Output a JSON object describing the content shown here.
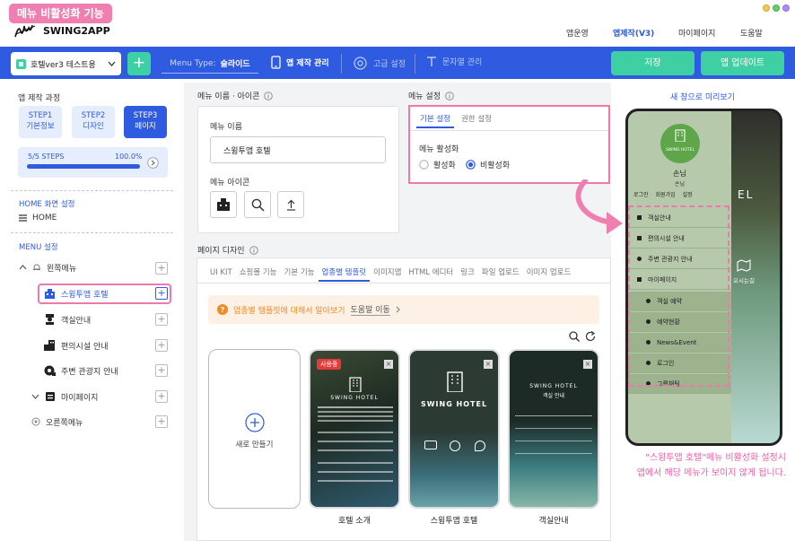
{
  "caption": "메뉴 비활성화 기능",
  "header": {
    "brand": "SWING2APP",
    "nav": [
      "앱운영",
      "앱제작(V3)",
      "마이페이지",
      "도움말"
    ]
  },
  "toolbar": {
    "app_name": "호텔ver3 테스트용",
    "menu_type_label": "Menu Type:",
    "menu_type_value": "슬라이드",
    "manage": "앱 제작 관리",
    "advanced": "고급 설정",
    "strings": "문자열 관리",
    "save": "저장",
    "update": "앱 업데이트"
  },
  "left": {
    "process_title": "앱 제작 과정",
    "steps": [
      {
        "line1": "STEP1",
        "line2": "기본정보"
      },
      {
        "line1": "STEP2",
        "line2": "디자인"
      },
      {
        "line1": "STEP3",
        "line2": "페이지"
      }
    ],
    "progress_label": "5/5 STEPS",
    "progress_text": "100.0%",
    "progress_value": 1.0,
    "home_section": "HOME 화면 설정",
    "home_item": "HOME",
    "menu_section": "MENU 설정",
    "tree": {
      "left_menu": "왼쪽메뉴",
      "items": [
        "스윙투앱 호텔",
        "객실안내",
        "편의시설 안내",
        "주변 관광지 안내"
      ],
      "mypage": "마이페이지",
      "right_menu": "오른쪽메뉴"
    }
  },
  "menu_name_panel": {
    "title": "메뉴 이름 · 아이콘",
    "name_label": "메뉴 이름",
    "name_value": "스윙투앱 호텔",
    "icon_label": "메뉴 아이콘"
  },
  "menu_settings": {
    "title": "메뉴 설정",
    "tabs": [
      "기본 설정",
      "권한 설정"
    ],
    "activate_label": "메뉴 활성화",
    "options": [
      "활성화",
      "비활성화"
    ],
    "selected": "비활성화"
  },
  "page_design": {
    "title": "페이지 디자인",
    "tabs": [
      "UI KIT",
      "쇼핑몰 기능",
      "기본 기능",
      "업종별 템플릿",
      "이미지맵",
      "HTML 에디터",
      "링크",
      "파일 업로드",
      "이미지 업로드"
    ],
    "active_tab": "업종별 템플릿",
    "banner_text": "업종별 템플릿에 대해서 알아보기",
    "banner_link": "도움말 이동",
    "new_label": "새로 만들기",
    "templates": [
      {
        "label": "호텔 소개",
        "badge": "사용중",
        "heading": "SWING HOTEL"
      },
      {
        "label": "스윙투앱 호텔",
        "heading": "SWING HOTEL"
      },
      {
        "label": "객실안내",
        "heading": "SWING HOTEL",
        "sub": "객실 안내"
      }
    ]
  },
  "preview": {
    "link": "새 창으로 미리보기",
    "hotel_name": "SWING HOTEL",
    "user": "손님",
    "user_sub": "손님",
    "actions": [
      "로그인",
      "회원가입",
      "설정"
    ],
    "menu": [
      "객실안내",
      "편의시설 안내",
      "주변 관광지 안내",
      "마이페이지"
    ],
    "submenu": [
      "객실 예약",
      "예약현황",
      "News&Event",
      "로그인",
      "그룹채팅"
    ],
    "right_label": "오시는길",
    "right_text": "EL"
  },
  "note": {
    "line1": "\"스윙투앱 호텔\"메뉴 비활성화 설정시",
    "line2": "앱에서 해당 메뉴가 보이지 않게 됩니다."
  },
  "colors": {
    "brand_blue": "#2e5be0",
    "mint": "#3ecfa2",
    "pink": "#ee79ad"
  }
}
